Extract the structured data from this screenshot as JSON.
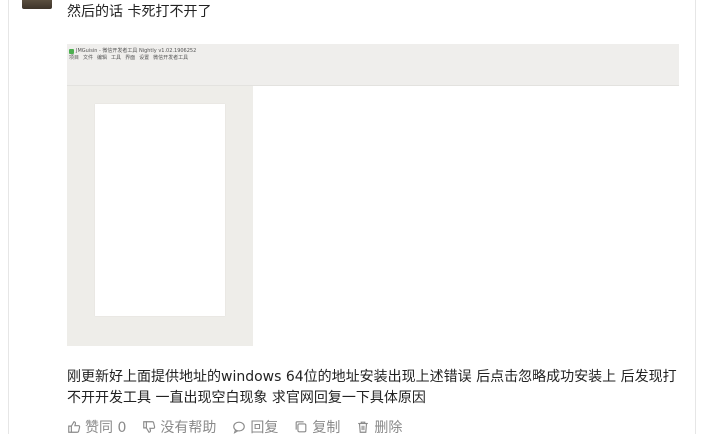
{
  "post": {
    "first_line": "然后的话 卡死打不开了",
    "body": "刚更新好上面提供地址的windows 64位的地址安装出现上述错误 后点击忽略成功安装上 后发现打不开开发工具 一直出现空白现象 求官网回复一下具体原因"
  },
  "embedded_screenshot": {
    "title": "JMGuisin - 微信开发者工具 Nightly v1.02.1906252",
    "menu": [
      "项目",
      "文件",
      "编辑",
      "工具",
      "界面",
      "设置",
      "微信开发者工具"
    ]
  },
  "actions": {
    "like": "赞同 0",
    "not_helpful": "没有帮助",
    "reply": "回复",
    "copy": "复制",
    "delete": "删除"
  },
  "icons": {
    "like": "thumbs-up-icon",
    "not_helpful": "thumbs-down-icon",
    "reply": "comment-icon",
    "copy": "copy-icon",
    "delete": "trash-icon"
  }
}
